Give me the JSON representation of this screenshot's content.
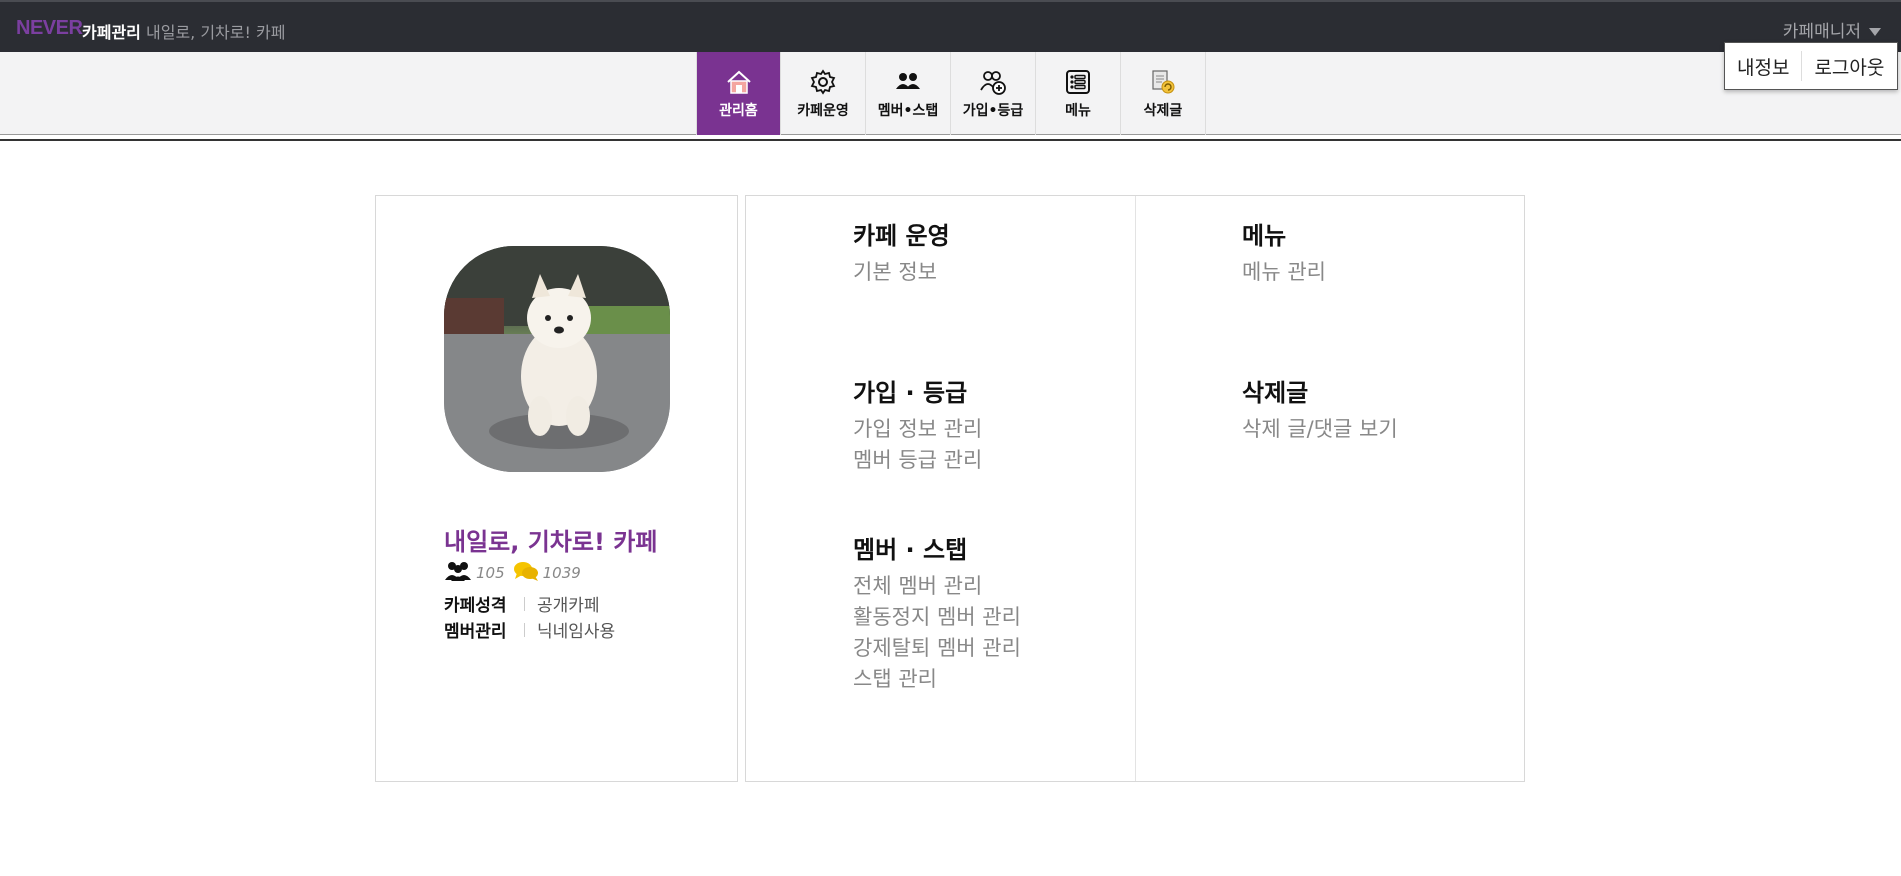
{
  "topbar": {
    "brand": "NEVER",
    "brand_sub": "카페관리",
    "cafe_name": "내일로, 기차로! 카페",
    "manager": "카페매니저"
  },
  "dropdown": {
    "my_info": "내정보",
    "logout": "로그아웃"
  },
  "subnav": {
    "items": [
      {
        "label": "관리홈",
        "icon": "home-icon"
      },
      {
        "label": "카페운영",
        "icon": "gear-icon"
      },
      {
        "label": "멤버•스탭",
        "icon": "members-icon"
      },
      {
        "label": "가입•등급",
        "icon": "join-grade-icon"
      },
      {
        "label": "메뉴",
        "icon": "list-icon"
      },
      {
        "label": "삭제글",
        "icon": "deleted-post-icon"
      }
    ],
    "active_color": "#7a3391"
  },
  "profile": {
    "name": "내일로, 기차로! 카페",
    "members": "105",
    "posts": "1039",
    "type_label": "카페성격",
    "type_value": "공개카페",
    "member_label": "멤버관리",
    "member_value": "닉네임사용"
  },
  "menu_sections": {
    "operation": {
      "title": "카페 운영",
      "links": [
        "기본 정보"
      ]
    },
    "join": {
      "title": "가입 · 등급",
      "links": [
        "가입 정보 관리",
        "멤버 등급 관리"
      ]
    },
    "member": {
      "title": "멤버 · 스탭",
      "links": [
        "전체 멤버 관리",
        "활동정지 멤버 관리",
        "강제탈퇴 멤버 관리",
        "스탭 관리"
      ]
    },
    "menu": {
      "title": "메뉴",
      "links": [
        "메뉴 관리"
      ]
    },
    "deleted": {
      "title": "삭제글",
      "links": [
        "삭제 글/댓글 보기"
      ]
    }
  }
}
